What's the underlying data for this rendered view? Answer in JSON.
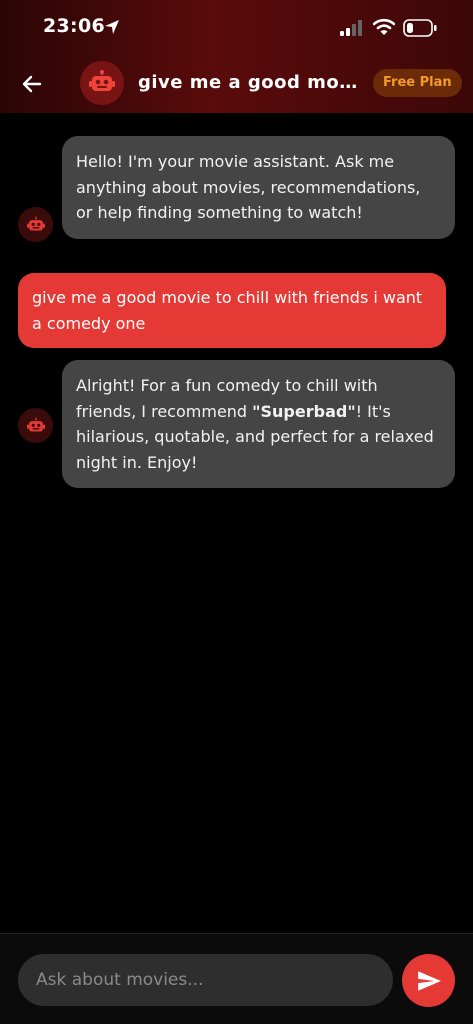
{
  "status_bar": {
    "time": "23:06"
  },
  "header": {
    "title": "give me a good movi...",
    "plan_badge": "Free Plan"
  },
  "messages": [
    {
      "role": "assistant",
      "text": "Hello! I'm your movie assistant. Ask me anything about movies, recommendations, or help finding something to watch!"
    },
    {
      "role": "user",
      "text": "give me a good movie to chill with friends i want a comedy one"
    },
    {
      "role": "assistant",
      "text_before": "Alright! For a fun comedy to chill with friends, I recommend ",
      "bold": "\"Superbad\"",
      "text_after": "! It's hilarious, quotable, and perfect for a relaxed night in. Enjoy!"
    }
  ],
  "composer": {
    "placeholder": "Ask about movies..."
  },
  "colors": {
    "accent": "#e53935",
    "bot_bubble": "#454545",
    "badge_text": "#f39a2a"
  },
  "icons": [
    "location-arrow-icon",
    "signal-icon",
    "wifi-icon",
    "battery-icon",
    "back-arrow-icon",
    "robot-icon",
    "send-icon"
  ]
}
